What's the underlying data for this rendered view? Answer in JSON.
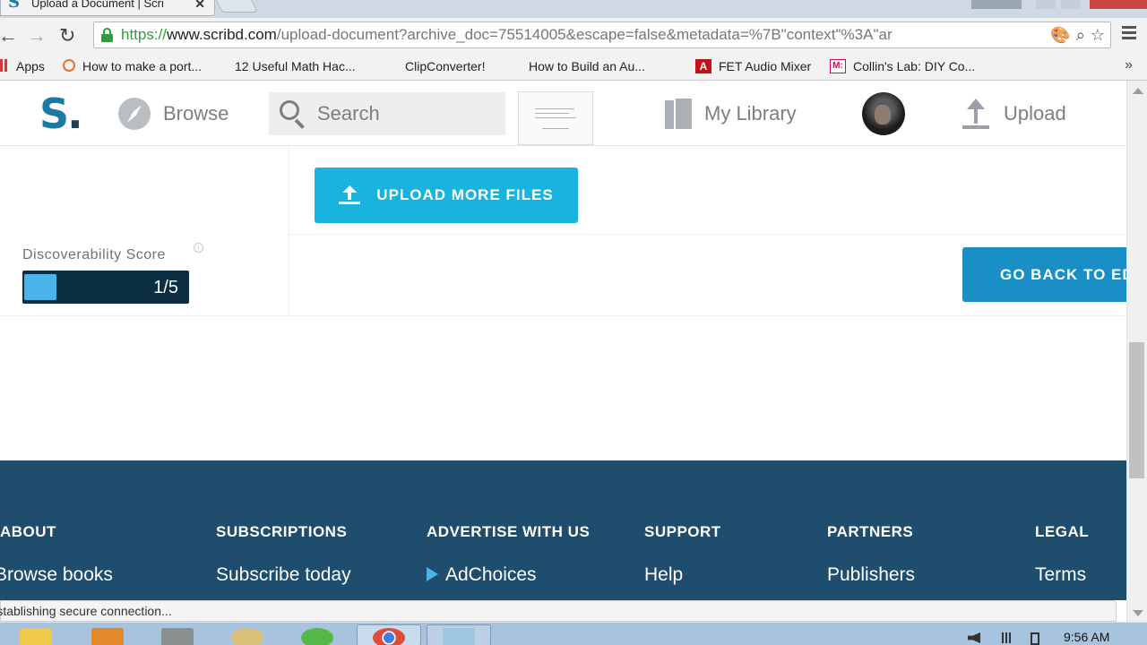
{
  "browser": {
    "tab_title": "Upload a Document | Scri",
    "url_scheme": "https://",
    "url_host": "www.scribd.com",
    "url_path": "/upload-document?archive_doc=75514005&escape=false&metadata=%7B\"context\"%3A\"ar"
  },
  "bookmarks": [
    {
      "label": "Apps",
      "icon": "apps-icon"
    },
    {
      "label": "How to make a port...",
      "icon": "site-icon"
    },
    {
      "label": "12 Useful Math Hac...",
      "icon": "page-icon"
    },
    {
      "label": "ClipConverter!",
      "icon": "page-icon"
    },
    {
      "label": "How to Build an Au...",
      "icon": "page-icon"
    },
    {
      "label": "FET Audio Mixer",
      "icon": "fet-icon"
    },
    {
      "label": "Collin's Lab: DIY Co...",
      "icon": "makezine-icon"
    }
  ],
  "bookmarks_more": "»",
  "header": {
    "logo_letter": "S",
    "logo_dot": ".",
    "browse_label": "Browse",
    "search_placeholder": "Search",
    "library_label": "My Library",
    "upload_label": "Upload"
  },
  "main": {
    "upload_more_label": "UPLOAD MORE FILES",
    "discoverability_label": "Discoverability Score",
    "score_text": "1/5",
    "score_fraction": 0.2,
    "go_back_label": "GO BACK TO EDIT"
  },
  "footer": {
    "columns": [
      {
        "heading": "ABOUT",
        "link": "Browse books"
      },
      {
        "heading": "SUBSCRIPTIONS",
        "link": "Subscribe today"
      },
      {
        "heading": "ADVERTISE WITH US",
        "link": "AdChoices"
      },
      {
        "heading": "SUPPORT",
        "link": "Help"
      },
      {
        "heading": "PARTNERS",
        "link": "Publishers"
      },
      {
        "heading": "LEGAL",
        "link": "Terms"
      }
    ]
  },
  "status_text": "Establishing secure connection...",
  "taskbar": {
    "clock": "9:56 AM"
  },
  "colors": {
    "brand_blue": "#1a7aa3",
    "upload_button": "#1ab3de",
    "go_back_button": "#1a8fc6",
    "footer_bg": "#1e4d6e",
    "score_bar_bg": "#0c2e42",
    "score_fill": "#4ab4ea"
  }
}
